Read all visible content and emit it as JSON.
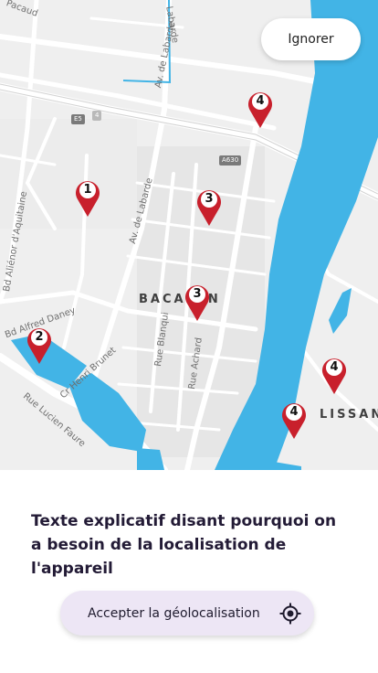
{
  "map": {
    "skip_label": "Ignorer",
    "street_labels": {
      "pacaud": "Pacaud",
      "labarde_top": "Labarde",
      "av_labarde": "Av. de Labarde",
      "av_labarde_2": "Av. de Labarde",
      "bd_alienor": "Bd Aliénor d'Aquitaine",
      "bd_alfred": "Bd Alfred Daney",
      "rue_blanqui": "Rue Blanqui",
      "rue_achard": "Rue Achard",
      "cr_henri": "Cr Henri Brunet",
      "rue_lucien": "Rue Lucien Faure"
    },
    "road_shields": {
      "e5": "E5",
      "n4": "4",
      "a630": "A630"
    },
    "districts": {
      "bacalan": "BACALAN",
      "lissan": "LISSAN"
    },
    "markers": [
      {
        "label": "4",
        "color": "#c8202c"
      },
      {
        "label": "1",
        "color": "#c8202c"
      },
      {
        "label": "3",
        "color": "#c8202c"
      },
      {
        "label": "3",
        "color": "#c8202c"
      },
      {
        "label": "2",
        "color": "#c8202c"
      },
      {
        "label": "4",
        "color": "#c8202c"
      },
      {
        "label": "4",
        "color": "#c8202c"
      }
    ],
    "colors": {
      "water": "#42b4e6",
      "land": "#efefef",
      "road": "#ffffff"
    }
  },
  "sheet": {
    "explanation": "Texte explicatif disant pourquoi on a besoin de la localisation de l'appareil",
    "accept_label": "Accepter la géolocalisation",
    "accept_icon": "gps-locate-icon",
    "accent_bg": "#ede6f5"
  }
}
